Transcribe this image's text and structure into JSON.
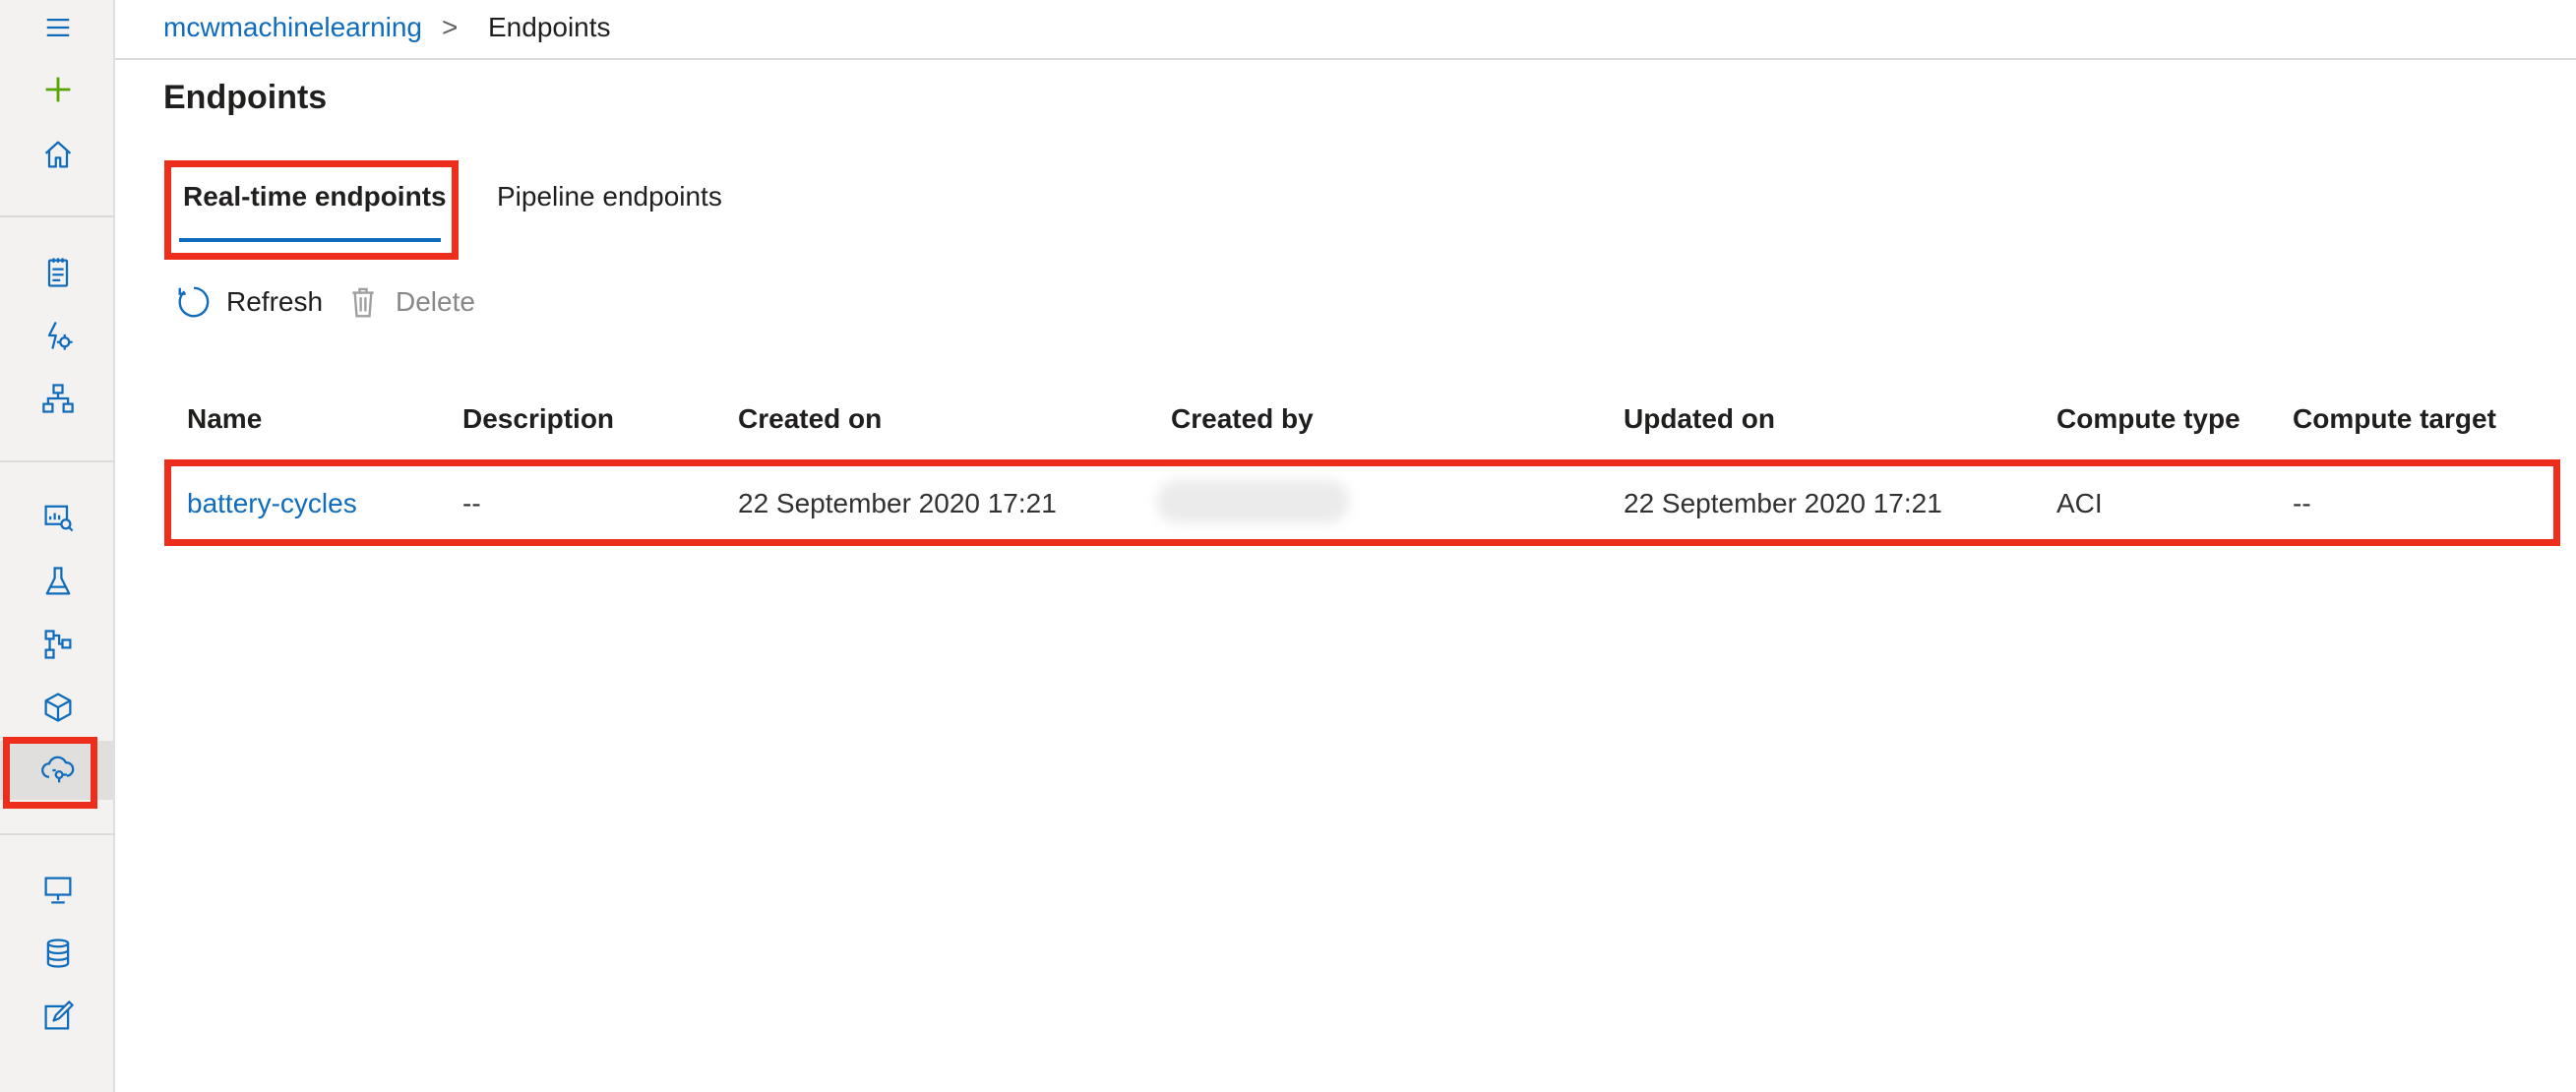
{
  "breadcrumb": {
    "workspace": "mcwmachinelearning",
    "separator": ">",
    "current": "Endpoints"
  },
  "page": {
    "title": "Endpoints"
  },
  "tabs": [
    {
      "label": "Real-time endpoints",
      "selected": true
    },
    {
      "label": "Pipeline endpoints",
      "selected": false
    }
  ],
  "toolbar": {
    "refresh_label": "Refresh",
    "delete_label": "Delete",
    "delete_enabled": false
  },
  "table": {
    "columns": [
      "Name",
      "Description",
      "Created on",
      "Created by",
      "Updated on",
      "Compute type",
      "Compute target"
    ],
    "rows": [
      {
        "name": "battery-cycles",
        "description": "--",
        "created_on": "22 September 2020 17:21",
        "created_by": "",
        "updated_on": "22 September 2020 17:21",
        "compute_type": "ACI",
        "compute_target": "--"
      }
    ]
  },
  "nav_icons": [
    "hamburger-icon",
    "plus-icon",
    "home-icon",
    "notebook-icon",
    "automl-icon",
    "designer-icon",
    "datasets-icon",
    "experiments-icon",
    "pipelines-icon",
    "models-icon",
    "endpoints-icon",
    "compute-icon",
    "datastores-icon",
    "data-labeling-icon"
  ],
  "colors": {
    "accent": "#0f6cbd",
    "new_green": "#57a300",
    "highlight": "#ed2e1c",
    "rail_bg": "#f3f2f1"
  }
}
